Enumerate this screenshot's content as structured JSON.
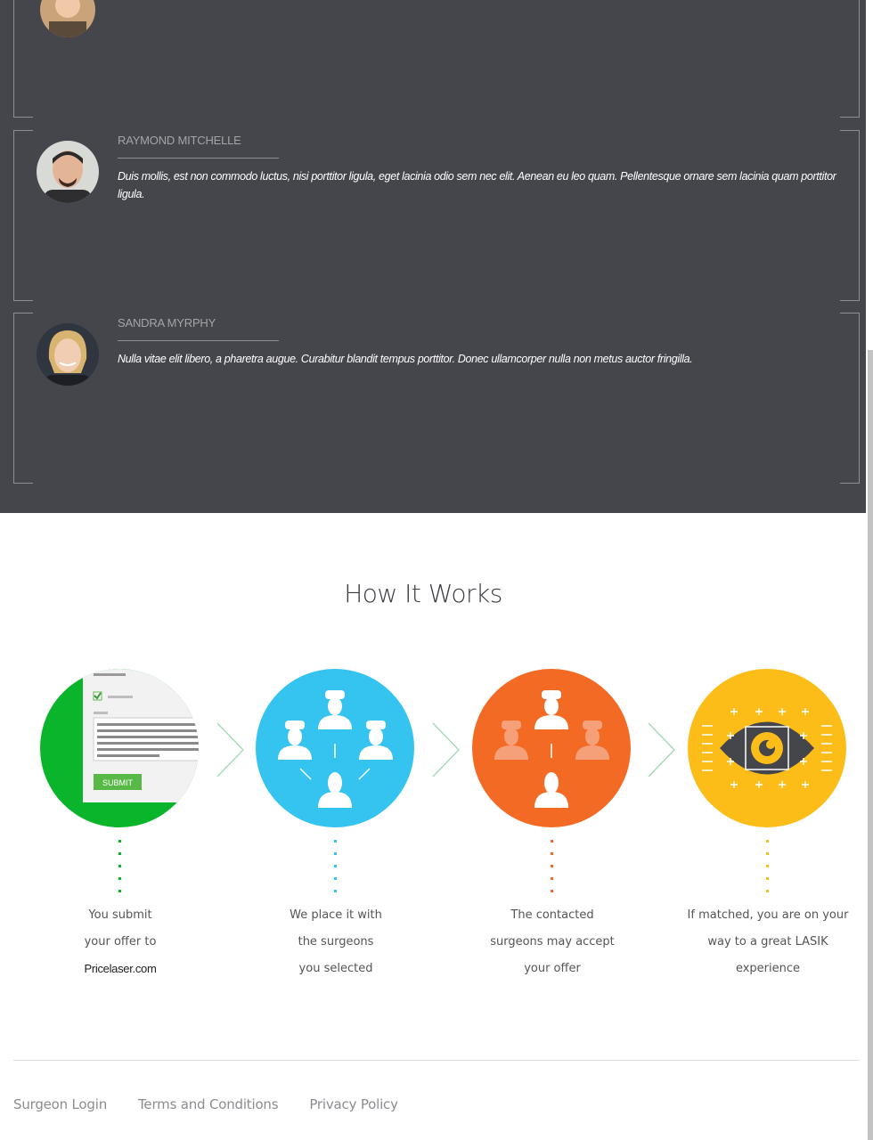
{
  "testimonials": [
    {
      "name": "",
      "text": ""
    },
    {
      "name": "RAYMOND MITCHELLE",
      "text": "Duis mollis, est non commodo luctus, nisi porttitor ligula, eget lacinia odio sem nec elit. Aenean eu leo quam. Pellentesque ornare sem lacinia quam porttitor ligula."
    },
    {
      "name": "SANDRA MYRPHY",
      "text": "Nulla vitae elit libero, a pharetra augue. Curabitur blandit tempus porttitor. Donec ullamcorper nulla non metus auctor fringilla."
    }
  ],
  "how_it_works": {
    "title": "How It Works",
    "steps": [
      {
        "icon": "form-submit-icon",
        "color": "#0ab52c",
        "lines": [
          "You submit",
          "your offer to",
          "Pricelaser.com"
        ]
      },
      {
        "icon": "surgeons-network-icon",
        "color": "#35c3ef",
        "lines": [
          "We place it with",
          "the surgeons",
          "you selected"
        ]
      },
      {
        "icon": "surgeons-accept-icon",
        "color": "#f36a24",
        "lines": [
          "The contacted",
          "surgeons may accept",
          "your offer"
        ]
      },
      {
        "icon": "eye-icon",
        "color": "#fdbd19",
        "lines": [
          "If matched, you are on your",
          "way to a great LASIK",
          "experience"
        ]
      }
    ],
    "submit_label": "SUBMIT"
  },
  "footer": {
    "links": [
      "Surgeon Login",
      "Terms and Conditions",
      "Privacy Policy"
    ]
  }
}
